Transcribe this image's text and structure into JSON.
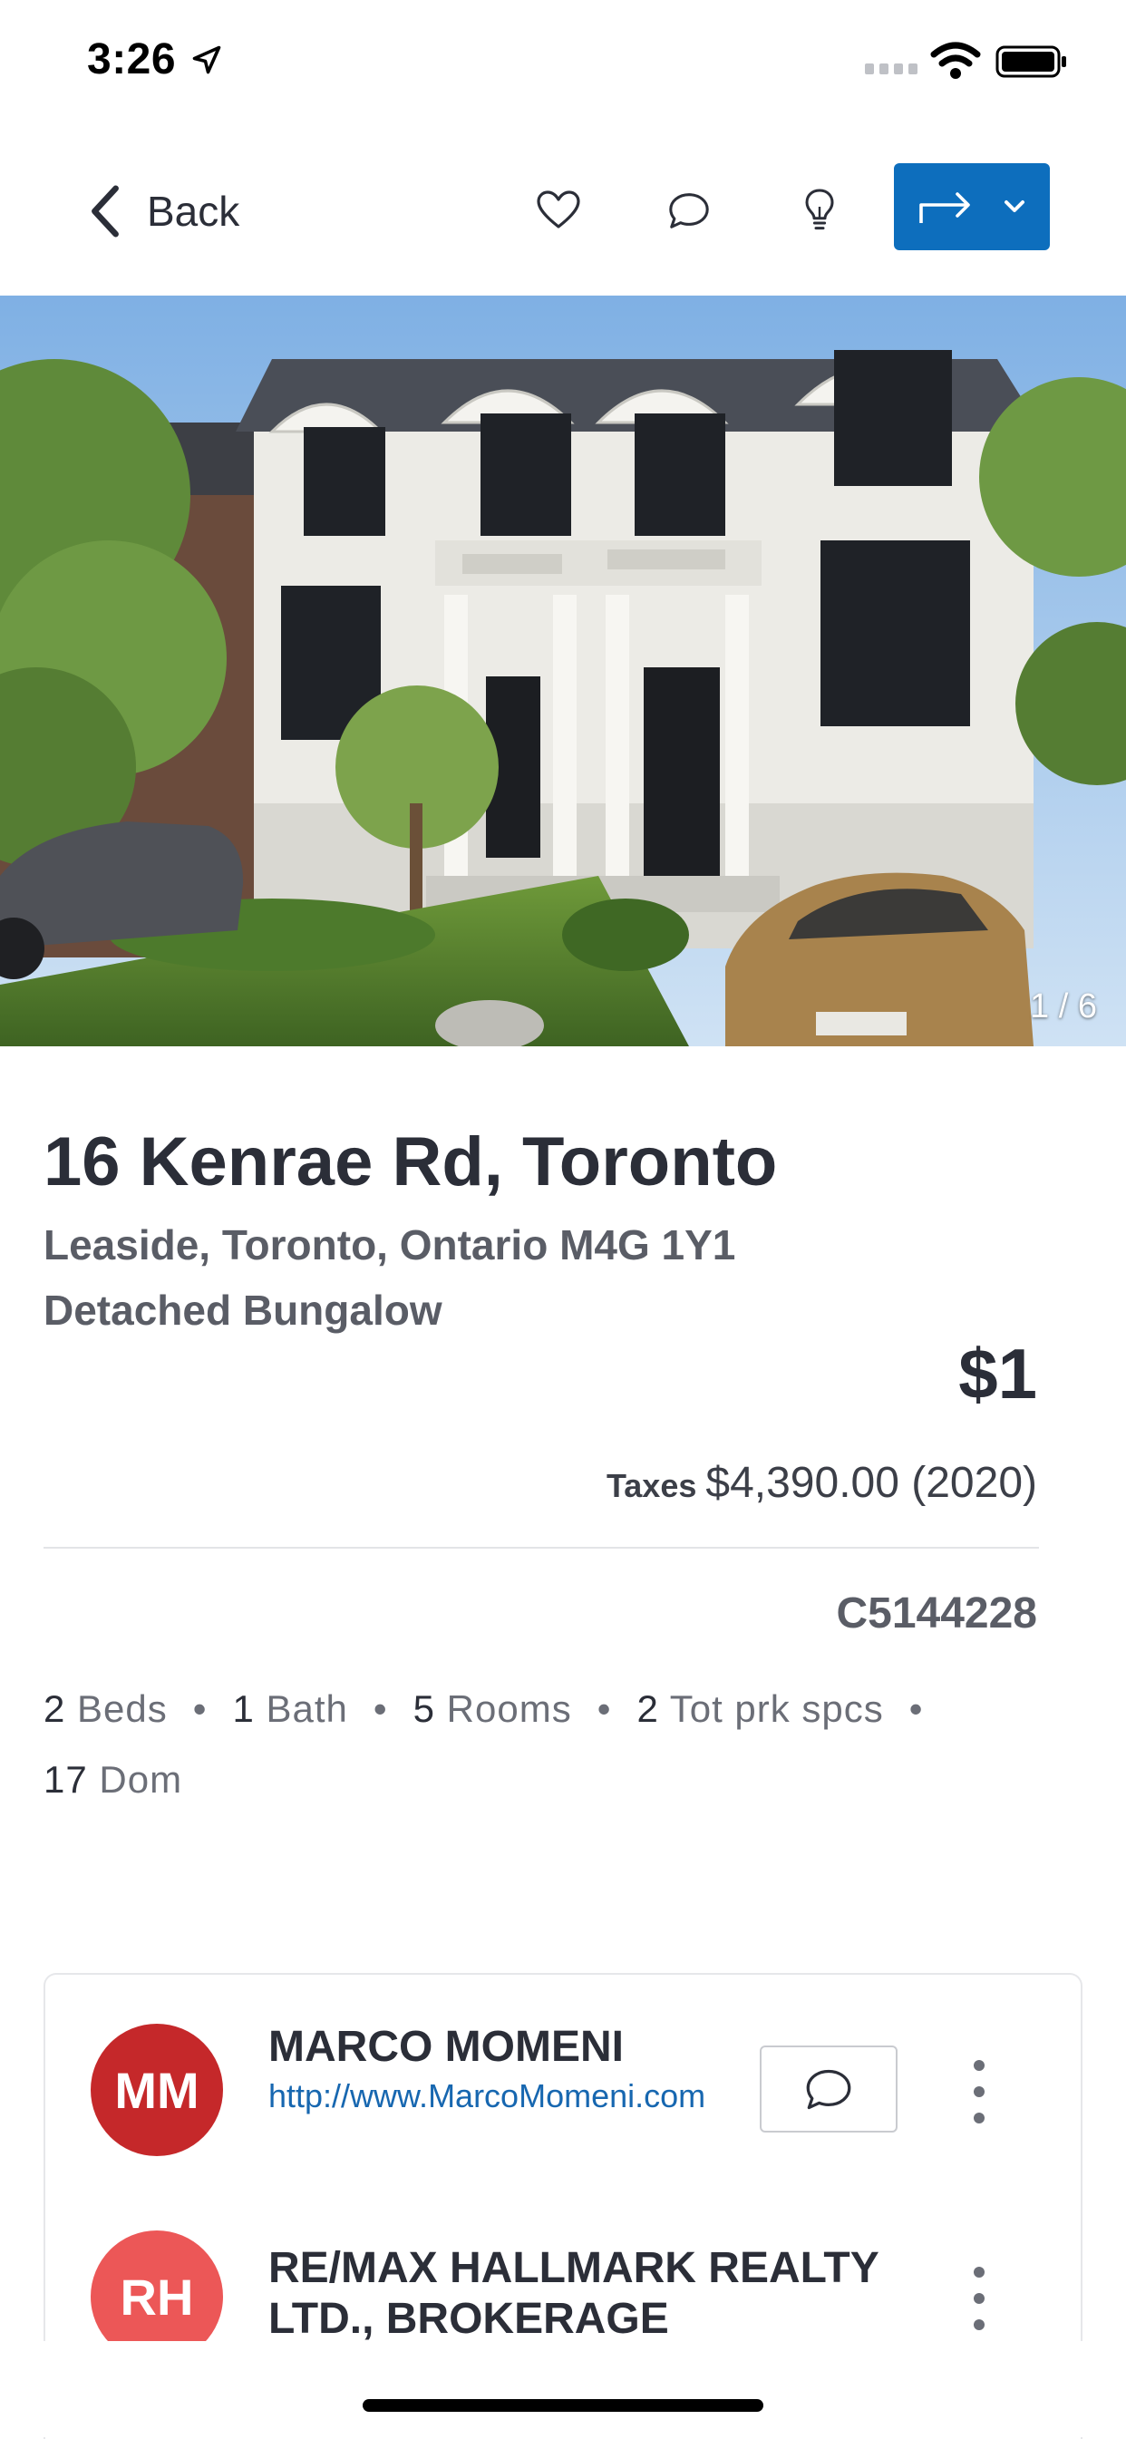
{
  "status_bar": {
    "time": "3:26"
  },
  "nav": {
    "back_label": "Back"
  },
  "hero": {
    "photo_counter": "1 / 6"
  },
  "listing": {
    "title": "16 Kenrae Rd, Toronto",
    "subtitle": "Leaside, Toronto, Ontario M4G 1Y1",
    "property_type": "Detached Bungalow",
    "price": "$1",
    "taxes_label": "Taxes",
    "taxes_value": "$4,390.00 (2020)",
    "mls_number": "C5144228",
    "stats": [
      {
        "num": "2",
        "label": "Beds"
      },
      {
        "num": "1",
        "label": "Bath"
      },
      {
        "num": "5",
        "label": "Rooms"
      },
      {
        "num": "2",
        "label": "Tot prk spcs"
      },
      {
        "num": "17",
        "label": "Dom"
      }
    ]
  },
  "agent": {
    "initials": "MM",
    "name": "MARCO MOMENI",
    "website": "http://www.MarcoMomeni.com"
  },
  "brokerage": {
    "initials": "RH",
    "name": "RE/MAX HALLMARK REALTY LTD., BROKERAGE"
  },
  "colors": {
    "accent_blue": "#0d6ebd",
    "agent_avatar": "#c5282a",
    "brokerage_avatar": "#ec5757",
    "link": "#1767b0"
  },
  "icons": [
    "location-arrow-icon",
    "signal-icon",
    "wifi-icon",
    "battery-icon",
    "back-chevron-icon",
    "heart-icon",
    "comment-icon",
    "lightbulb-icon",
    "share-arrow-icon",
    "chevron-down-icon",
    "kebab-menu-icon"
  ]
}
